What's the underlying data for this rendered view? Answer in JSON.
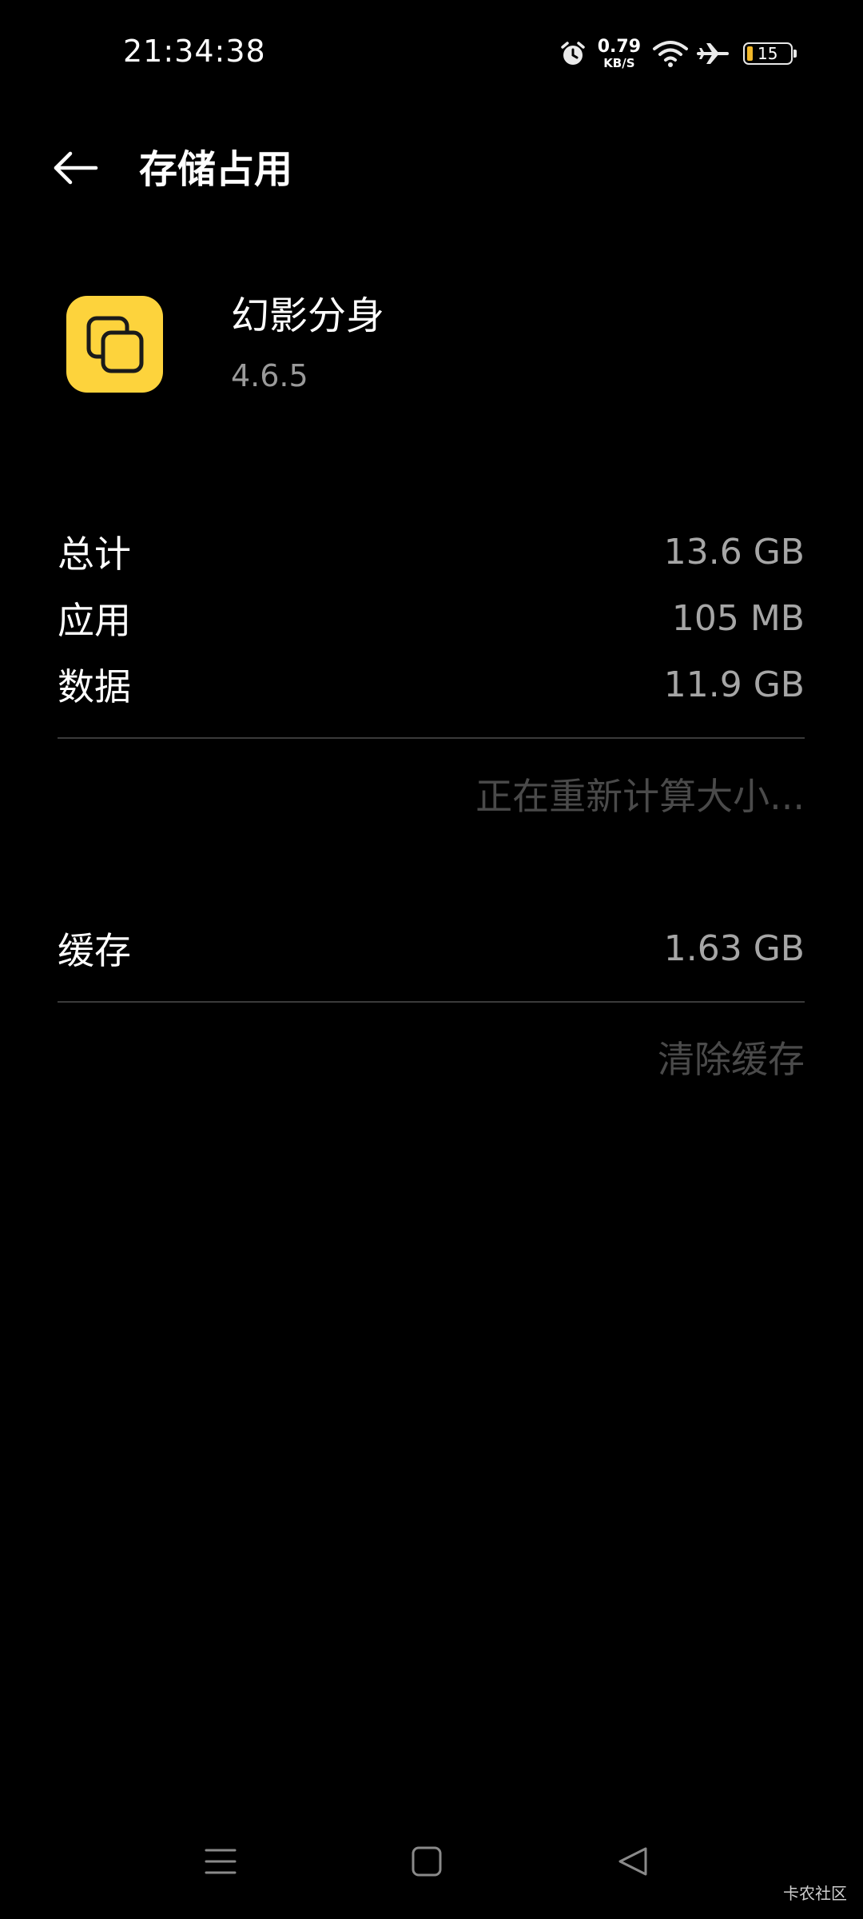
{
  "status_bar": {
    "time": "21:34:38",
    "net_speed_value": "0.79",
    "net_speed_unit": "KB/S",
    "battery_level": "15",
    "icons": [
      "alarm-icon",
      "wifi-icon",
      "airplane-icon",
      "battery-icon"
    ]
  },
  "header": {
    "back_icon": "arrow-left-icon",
    "title": "存储占用"
  },
  "app": {
    "name": "幻影分身",
    "version": "4.6.5",
    "icon_color": "#fdd33c"
  },
  "storage": {
    "total_label": "总计",
    "total_value": "13.6 GB",
    "app_label": "应用",
    "app_value": "105 MB",
    "data_label": "数据",
    "data_value": "11.9 GB",
    "recalculating_text": "正在重新计算大小..."
  },
  "cache": {
    "label": "缓存",
    "value": "1.63 GB",
    "clear_button": "清除缓存"
  },
  "nav_bar": {
    "icons": [
      "menu-icon",
      "home-icon",
      "back-triangle-icon"
    ]
  },
  "watermark": "卡农社区"
}
